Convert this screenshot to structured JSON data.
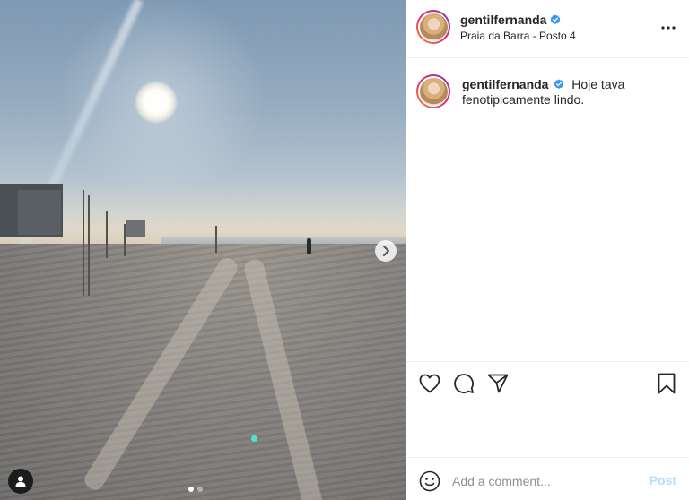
{
  "post": {
    "username": "gentilfernanda",
    "verified": true,
    "location": "Praia da Barra - Posto 4",
    "caption": "Hoje tava fenotipicamente lindo."
  },
  "carousel": {
    "slide_count": 2,
    "active_slide": 1
  },
  "icons": {
    "verified": "verified-badge-icon",
    "more": "more-options-icon",
    "like": "heart-icon",
    "comment": "comment-bubble-icon",
    "share": "paper-plane-icon",
    "save": "bookmark-icon",
    "emoji": "emoji-smiley-icon",
    "next": "chevron-right-icon",
    "tag": "user-tag-icon"
  },
  "comment_box": {
    "placeholder": "Add a comment...",
    "value": "",
    "post_label": "Post"
  },
  "colors": {
    "verified_blue": "#3897f0",
    "post_disabled": "#b2dffc",
    "text": "#262626",
    "muted": "#8e8e8e"
  }
}
